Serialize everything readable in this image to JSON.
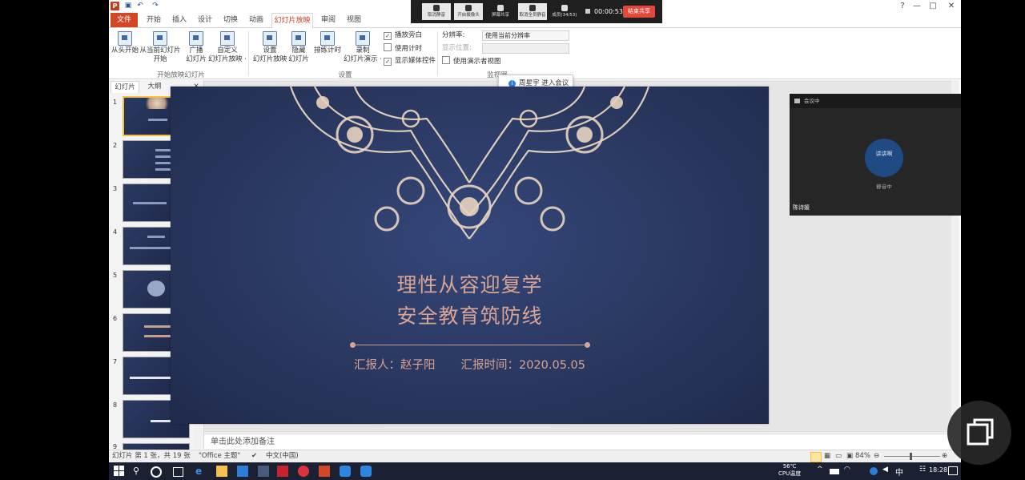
{
  "app": {
    "logo": "P",
    "quick_access": [
      "save-icon",
      "undo-icon",
      "redo-icon"
    ],
    "window_controls": [
      "?",
      "—",
      "□",
      "✕"
    ]
  },
  "tabs": [
    "文件",
    "开始",
    "插入",
    "设计",
    "切换",
    "动画",
    "幻灯片放映",
    "审阅",
    "视图"
  ],
  "ribbon": {
    "buttons": {
      "from_beginning": "从头开始",
      "from_current_1": "从当前幻灯片",
      "from_current_2": "开始",
      "broadcast_1": "广播",
      "broadcast_2": "幻灯片",
      "custom_1": "自定义",
      "custom_2": "幻灯片放映 ·",
      "setup_1": "设置",
      "setup_2": "幻灯片放映",
      "hide_1": "隐藏",
      "hide_2": "幻灯片",
      "rehearse": "排练计时",
      "record_1": "录制",
      "record_2": "幻灯片演示 ·"
    },
    "checkboxes": {
      "play_narration": "播放旁白",
      "use_timings": "使用计时",
      "show_media_controls": "显示媒体控件",
      "use_presenter_view": "使用演示者视图"
    },
    "checked": {
      "play_narration": "✓",
      "use_timings": "",
      "show_media_controls": "✓"
    },
    "monitors": {
      "resolution_label": "分辨率:",
      "resolution_value": "使用当前分辨率",
      "show_on_label": "显示位置:",
      "show_on_value": ""
    },
    "groups": {
      "start": "开始放映幻灯片",
      "setup": "设置",
      "monitors": "监视器"
    }
  },
  "notification": {
    "text": "周星宇 进入会议",
    "icon": "info-icon"
  },
  "left_pane": {
    "tabs": [
      "幻灯片",
      "大纲"
    ],
    "close": "✕",
    "slide_numbers": [
      "1",
      "2",
      "3",
      "4",
      "5",
      "6",
      "7",
      "8",
      "9"
    ]
  },
  "slide": {
    "title_line1": "理性从容迎复学",
    "title_line2": "安全教育筑防线",
    "reporter": "汇报人：赵子阳",
    "report_time": "汇报时间：2020.05.05",
    "colors": {
      "background": "#2a3860",
      "accent": "#d9a493",
      "ornament": "#e8d4c0"
    }
  },
  "notes_placeholder": "单击此处添加备注",
  "status_bar": {
    "slide_info": "幻灯片 第 1 张，共 19 张",
    "theme": "\"Office 主题\"",
    "language": "中文(中国)",
    "zoom": "84%"
  },
  "meeting": {
    "buttons": [
      "取消静音",
      "开启摄像头",
      "屏幕共享",
      "取消全员静音",
      "成员(34/53)"
    ],
    "timer": "00:00:53",
    "end_label": "结束共享",
    "video_title": "会议中",
    "avatar_text": "讲讲啊",
    "status": "静音中",
    "participant_name": "陈诗媛"
  },
  "taskbar": {
    "temp": "56℃",
    "temp_label": "CPU温度",
    "ime": "中",
    "time": "18:28"
  }
}
